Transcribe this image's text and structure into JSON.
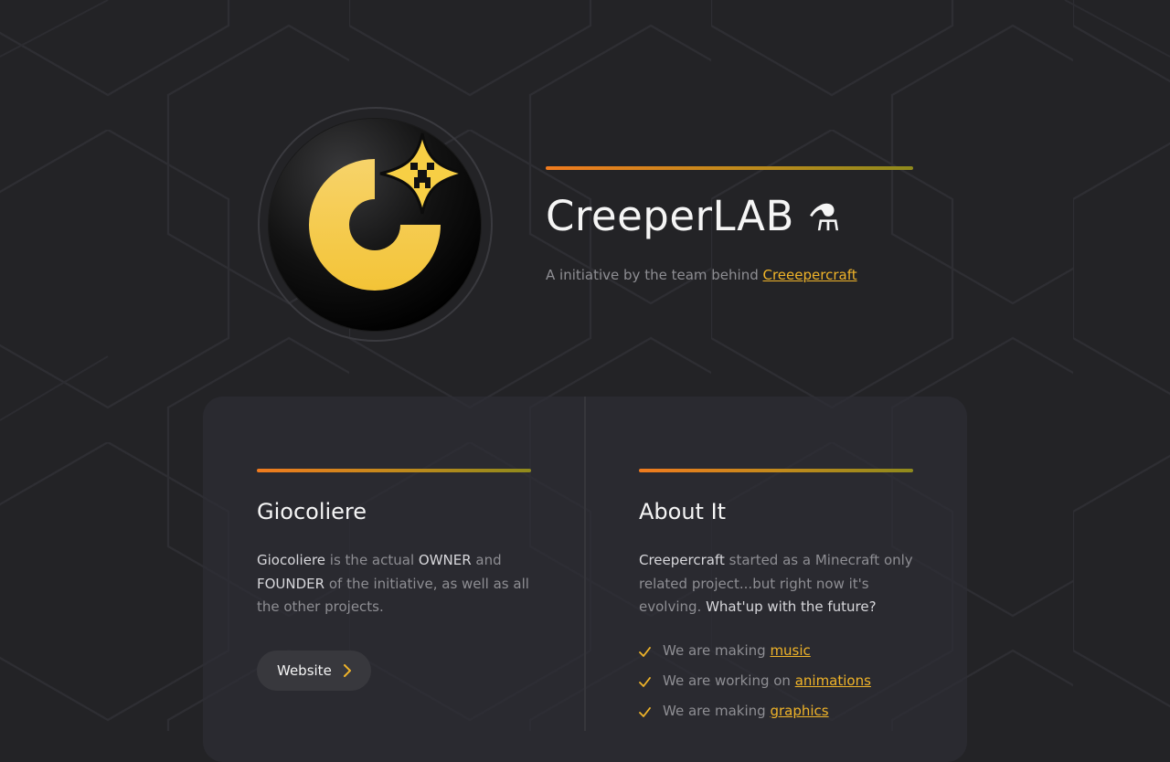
{
  "colors": {
    "background": "#232326",
    "accent": "#f0b429",
    "gradient_start": "#f07b1e",
    "gradient_end": "#8f8a1c"
  },
  "hero": {
    "logo_icon": "creeperlab-logo-icon",
    "title": "CreeperLAB",
    "title_icon": "flask-icon",
    "title_icon_glyph": "⚗",
    "subtitle_prefix": "A initiative by the team behind ",
    "subtitle_link": "Creeepercraft"
  },
  "owner_card": {
    "title": "Giocoliere",
    "text_parts": [
      {
        "text": "Giocoliere",
        "strong": true
      },
      {
        "text": " is the actual ",
        "strong": false
      },
      {
        "text": "OWNER",
        "strong": true
      },
      {
        "text": " and ",
        "strong": false
      },
      {
        "text": "FOUNDER",
        "strong": true
      },
      {
        "text": " of the initiative, as well as all the other projects.",
        "strong": false
      }
    ],
    "button_label": "Website",
    "button_icon": "chevron-right-icon"
  },
  "about_card": {
    "title": "About It",
    "text_parts": [
      {
        "text": "Creepercraft",
        "strong": true
      },
      {
        "text": " started as a Minecraft only related project...but right now it's evolving. ",
        "strong": false
      },
      {
        "text": "What'up with the future?",
        "strong": true
      }
    ],
    "items": [
      {
        "prefix": "We are making ",
        "link": "music",
        "icon": "check-icon"
      },
      {
        "prefix": "We are working on ",
        "link": "animations",
        "icon": "check-icon"
      },
      {
        "prefix": "We are making ",
        "link": "graphics",
        "icon": "check-icon"
      }
    ]
  }
}
